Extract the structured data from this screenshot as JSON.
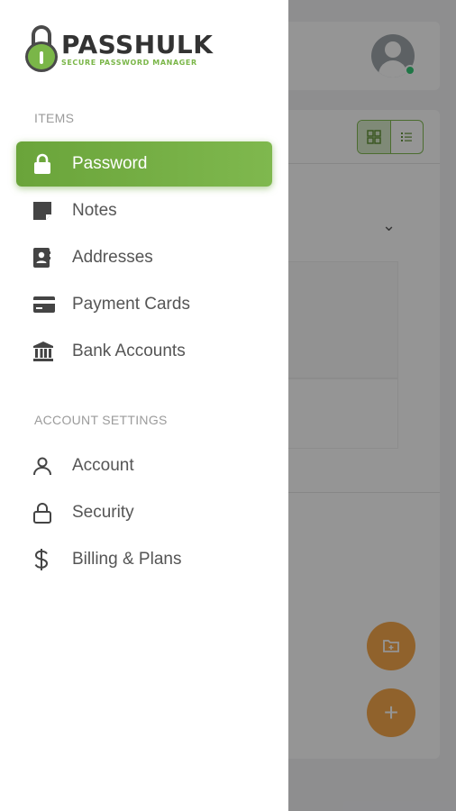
{
  "app": {
    "logo_title": "PASSHULK",
    "logo_subtitle": "SECURE PASSWORD MANAGER",
    "accent_color": "#7ab648",
    "fab_color": "#f6a340"
  },
  "drawer": {
    "items_section_label": "ITEMS",
    "items": [
      {
        "label": "Password",
        "icon": "lock-icon",
        "active": true
      },
      {
        "label": "Notes",
        "icon": "note-icon",
        "active": false
      },
      {
        "label": "Addresses",
        "icon": "address-book-icon",
        "active": false
      },
      {
        "label": "Payment Cards",
        "icon": "credit-card-icon",
        "active": false
      },
      {
        "label": "Bank Accounts",
        "icon": "bank-icon",
        "active": false
      }
    ],
    "account_section_label": "ACCOUNT SETTINGS",
    "account_items": [
      {
        "label": "Account",
        "icon": "user-icon"
      },
      {
        "label": "Security",
        "icon": "lock-outline-icon"
      },
      {
        "label": "Billing & Plans",
        "icon": "dollar-icon"
      }
    ]
  },
  "background": {
    "view_toggle": [
      "grid-view-icon",
      "list-view-icon"
    ],
    "dropdown_icon": "chevron-down-icon",
    "fab_buttons": [
      "new-folder-icon",
      "plus-icon"
    ],
    "fab_add_glyph": "+",
    "chevron_glyph": "⌄"
  }
}
